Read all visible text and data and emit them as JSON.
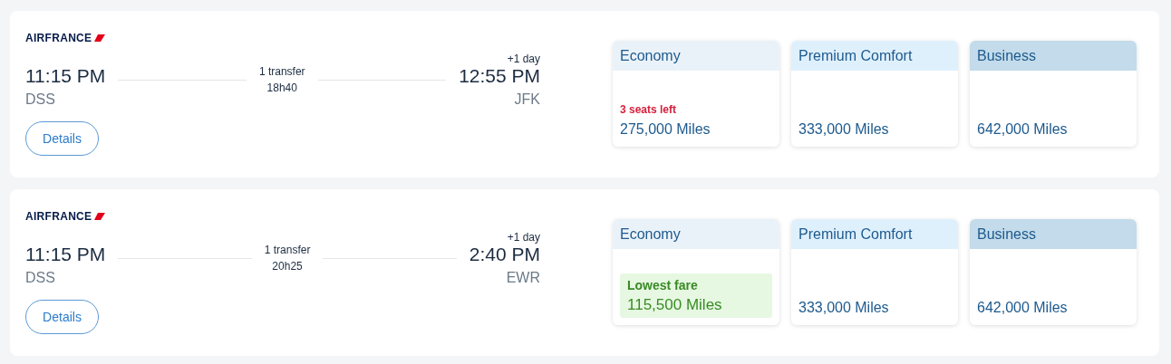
{
  "flights": [
    {
      "airline": "AIRFRANCE",
      "departure": {
        "time": "11:15 PM",
        "airport": "DSS"
      },
      "transfer": "1 transfer",
      "duration": "18h40",
      "arrival": {
        "day_offset": "+1 day",
        "time": "12:55 PM",
        "airport": "JFK"
      },
      "details_button": "Details",
      "fares": [
        {
          "kind": "economy",
          "cabin": "Economy",
          "note": {
            "kind": "seats_left",
            "text": "3 seats left"
          },
          "price": "275,000 Miles"
        },
        {
          "kind": "premium",
          "cabin": "Premium Comfort",
          "price": "333,000 Miles"
        },
        {
          "kind": "business",
          "cabin": "Business",
          "price": "642,000 Miles"
        }
      ]
    },
    {
      "airline": "AIRFRANCE",
      "departure": {
        "time": "11:15 PM",
        "airport": "DSS"
      },
      "transfer": "1 transfer",
      "duration": "20h25",
      "arrival": {
        "day_offset": "+1 day",
        "time": "2:40 PM",
        "airport": "EWR"
      },
      "details_button": "Details",
      "fares": [
        {
          "kind": "economy",
          "cabin": "Economy",
          "note": {
            "kind": "lowest_fare",
            "text": "Lowest fare"
          },
          "price": "115,500 Miles"
        },
        {
          "kind": "premium",
          "cabin": "Premium Comfort",
          "price": "333,000 Miles"
        },
        {
          "kind": "business",
          "cabin": "Business",
          "price": "642,000 Miles"
        }
      ]
    }
  ]
}
